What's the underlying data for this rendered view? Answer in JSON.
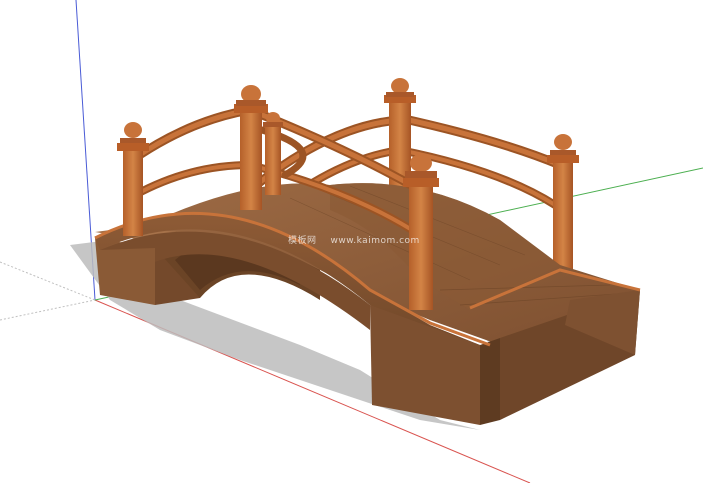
{
  "viewport": {
    "background": "#ffffff",
    "model": "wooden-arched-garden-bridge"
  },
  "axes": {
    "red": "#d9534f",
    "green": "#4caf50",
    "blue": "#4a5bd6"
  },
  "colors": {
    "wood_light": "#a9744a",
    "wood_mid": "#8c5a36",
    "wood_dark": "#6b4426",
    "rail_orange": "#c8733a",
    "rail_dark": "#9c5424",
    "shadow": "#b8b8b8"
  },
  "watermark": {
    "site_name": "模板网",
    "site_url": "www.kaimom.com"
  }
}
